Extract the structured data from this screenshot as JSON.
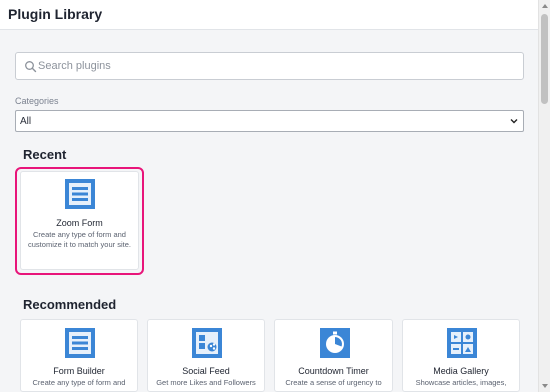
{
  "header": {
    "title": "Plugin Library"
  },
  "search": {
    "placeholder": "Search plugins",
    "icon": "search-icon"
  },
  "categories": {
    "label": "Categories",
    "selected": "All"
  },
  "recent": {
    "title": "Recent",
    "cards": [
      {
        "title": "Zoom Form",
        "description": "Create any type of form and customize it to match your site.",
        "icon": "form-icon"
      }
    ]
  },
  "recommended": {
    "title": "Recommended",
    "cards": [
      {
        "title": "Form Builder",
        "description": "Create any type of form and",
        "icon": "form-icon"
      },
      {
        "title": "Social Feed",
        "description": "Get more Likes and Followers",
        "icon": "social-feed-icon"
      },
      {
        "title": "Countdown Timer",
        "description": "Create a sense of urgency to",
        "icon": "timer-icon"
      },
      {
        "title": "Media Gallery",
        "description": "Showcase articles, images,",
        "icon": "gallery-icon"
      }
    ]
  },
  "colors": {
    "accent_blue": "#3b86d6",
    "highlight": "#e8157a"
  }
}
